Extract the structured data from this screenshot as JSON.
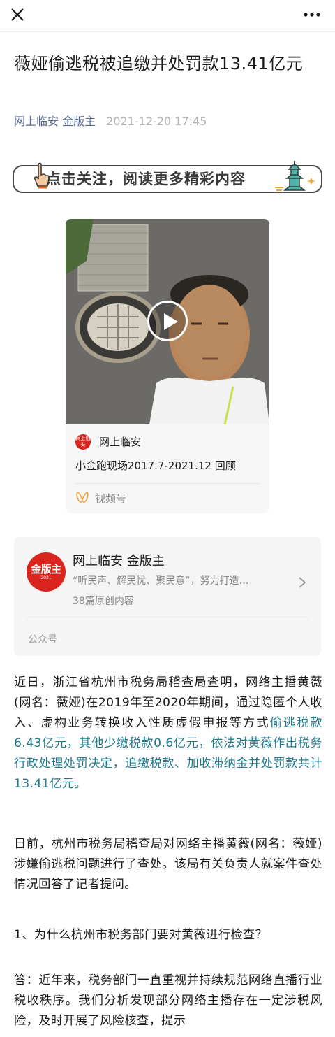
{
  "topbar": {
    "close_icon": "close-icon",
    "more_icon": "more-dots-icon"
  },
  "article": {
    "title": "薇娅偷逃税被追缴并处罚款13.41亿元",
    "author": "网上临安 金版主",
    "date": "2021-12-20 17:45"
  },
  "follow_banner": {
    "text": "点击关注，阅读更多精彩内容"
  },
  "video_card": {
    "account_name": "网上临安",
    "account_logo_text": "网上临安",
    "caption": "小金跑现场2017.7-2021.12 回顾",
    "channel_label": "视频号",
    "play_icon": "play-icon"
  },
  "official_account": {
    "logo_text": "金版主",
    "logo_year": "2021",
    "name": "网上临安 金版主",
    "description": "“听民声、解民忧、聚民意”，努力打造…",
    "count": "38篇原创内容",
    "type_label": "公众号"
  },
  "body": {
    "p1_plain": "近日，浙江省杭州市税务局稽查局查明，网络主播黄薇(网名：薇娅)在2019年至2020年期间，通过隐匿个人收入、虚构业务转换收入性质虚假申报等方式",
    "p1_highlight": "偷逃税款6.43亿元，其他少缴税款0.6亿元，依法对黄薇作出税务行政处理处罚决定，追缴税款、加收滞纳金并处罚款共计13.41亿元。",
    "p2": "日前，杭州市税务局稽查局对网络主播黄薇(网名：薇娅)涉嫌偷逃税问题进行了查处。该局有关负责人就案件查处情况回答了记者提问。",
    "p3": "1、为什么杭州市税务部门要对黄薇进行检查？",
    "p4": "答：近年来，税务部门一直重视并持续规范网络直播行业税收秩序。我们分析发现部分网络主播存在一定涉税风险，及时开展了风险核查，提示"
  },
  "colors": {
    "link": "#576b95",
    "highlight": "#1f7a8c",
    "brand_red": "#d9251d"
  }
}
